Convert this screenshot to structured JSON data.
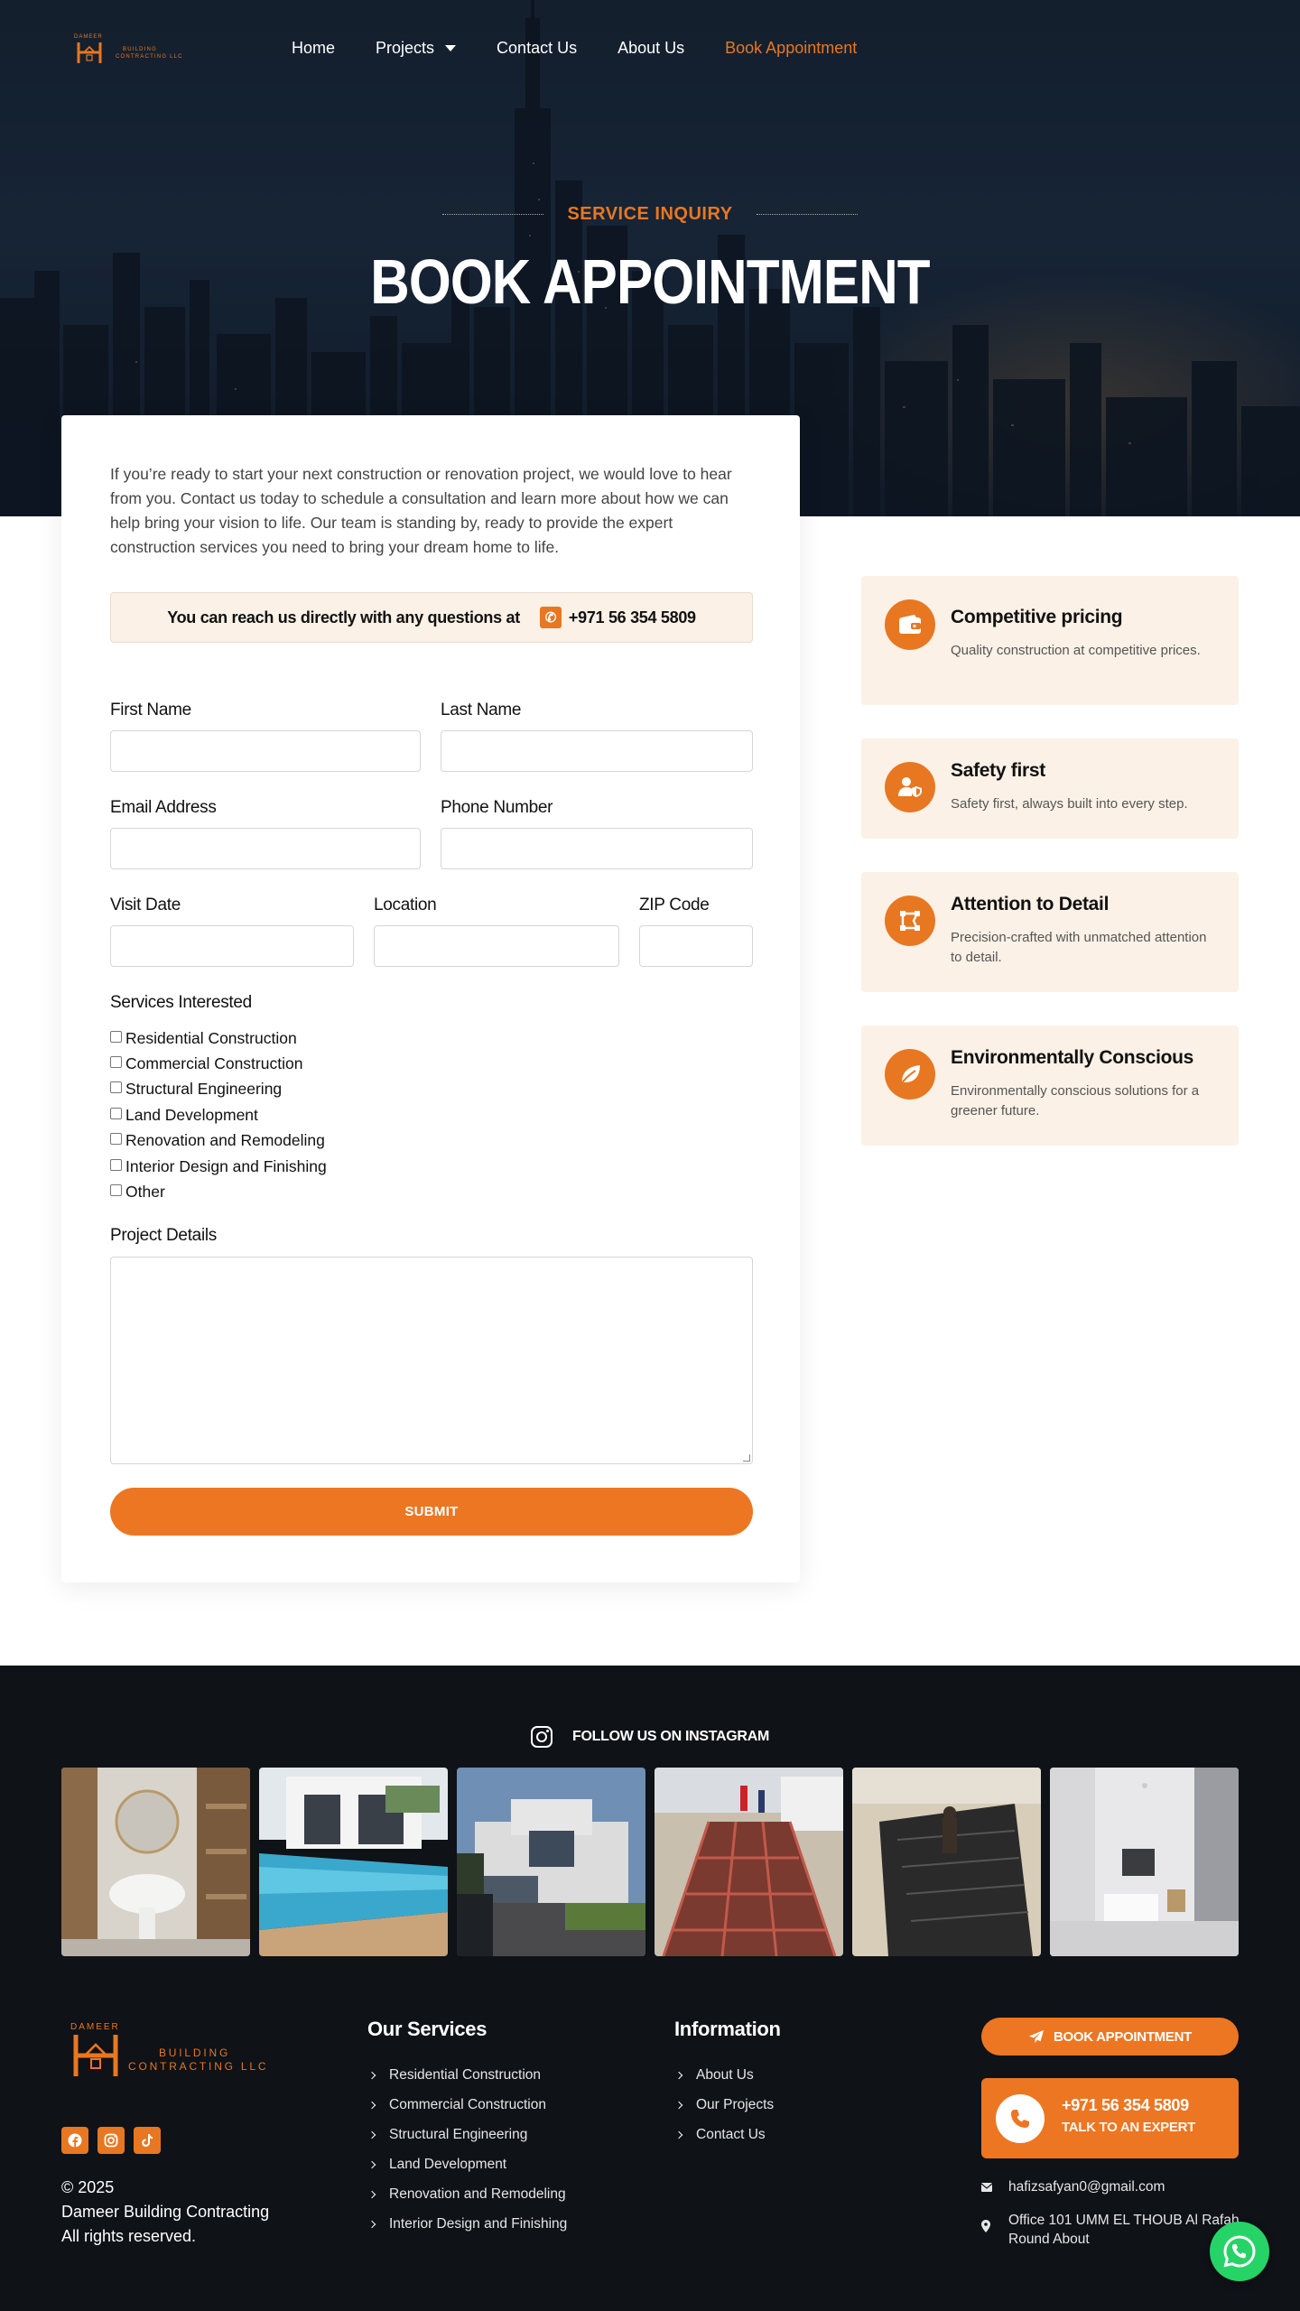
{
  "brand": {
    "logo_top": "DAMEER",
    "logo_line1": "BUILDING",
    "logo_line2": "CONTRACTING LLC"
  },
  "nav": {
    "items": [
      {
        "label": "Home"
      },
      {
        "label": "Projects"
      },
      {
        "label": "Contact Us"
      },
      {
        "label": "About Us"
      },
      {
        "label": "Book Appointment"
      }
    ]
  },
  "hero": {
    "eyebrow": "SERVICE INQUIRY",
    "title": "BOOK APPOINTMENT"
  },
  "form": {
    "intro": "If you’re ready to start your next construction or renovation project, we would love to hear from you. Contact us today to schedule a consultation and learn more about how we can help bring your vision to life. Our team is standing by, ready to provide the expert construction services you need to bring your dream home to life.",
    "reach_text": "You can reach us directly with any questions at",
    "reach_phone": "+971 56 354 5809",
    "labels": {
      "first_name": "First Name",
      "last_name": "Last Name",
      "email": "Email Address",
      "phone": "Phone Number",
      "visit_date": "Visit Date",
      "location": "Location",
      "zip": "ZIP Code",
      "services": "Services Interested",
      "details": "Project Details"
    },
    "values": {
      "first_name": "",
      "last_name": "",
      "email": "",
      "phone": "",
      "visit_date": "",
      "location": "",
      "zip": "",
      "details": ""
    },
    "services": [
      {
        "label": "Residential Construction",
        "checked": false
      },
      {
        "label": "Commercial Construction",
        "checked": false
      },
      {
        "label": "Structural Engineering",
        "checked": false
      },
      {
        "label": "Land Development",
        "checked": false
      },
      {
        "label": "Renovation and Remodeling",
        "checked": false
      },
      {
        "label": "Interior Design and Finishing",
        "checked": false
      },
      {
        "label": "Other",
        "checked": false
      }
    ],
    "submit": "SUBMIT"
  },
  "features": [
    {
      "title": "Competitive pricing",
      "desc": "Quality construction at competitive prices.",
      "icon": "wallet-icon"
    },
    {
      "title": "Safety first",
      "desc": "Safety first, always built into every step.",
      "icon": "user-shield-icon"
    },
    {
      "title": "Attention to Detail",
      "desc": "Precision-crafted with unmatched attention to detail.",
      "icon": "draw-polygon-icon"
    },
    {
      "title": "Environmentally Conscious",
      "desc": "Environmentally conscious solutions for a greener future.",
      "icon": "leaf-icon"
    }
  ],
  "instagram": {
    "heading": "FOLLOW US ON INSTAGRAM"
  },
  "footer": {
    "copyright": "©  2025",
    "company": "Dameer Building Contracting",
    "rights": "All rights reserved.",
    "services_title": "Our Services",
    "services": [
      "Residential Construction",
      "Commercial Construction",
      "Structural Engineering",
      "Land Development",
      "Renovation and Remodeling",
      "Interior Design and Finishing"
    ],
    "info_title": "Information",
    "info": [
      "About Us",
      "Our Projects",
      "Contact Us"
    ],
    "book_button": "BOOK APPOINTMENT",
    "call_number": "+971 56 354 5809",
    "call_sub": "TALK TO AN EXPERT",
    "email": "hafizsafyan0@gmail.com",
    "address_line1": "Office 101 UMM EL THOUB Al Rafah",
    "address_line2": "Round About"
  },
  "colors": {
    "accent": "#e87722",
    "footer_bg": "#0f1217",
    "feature_bg": "#fbf1e6",
    "whatsapp": "#25d366"
  }
}
